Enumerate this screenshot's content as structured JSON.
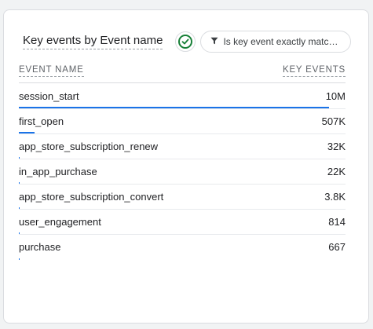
{
  "card": {
    "title": "Key events by Event name",
    "filter": {
      "icon": "filter-icon",
      "label": "Is key event exactly matc…"
    },
    "status_icon": "check-circle-icon",
    "columns": {
      "event_name": "EVENT NAME",
      "key_events": "KEY EVENTS"
    },
    "accent_color": "#1a73e8",
    "check_color": "#188038"
  },
  "chart_data": {
    "type": "table",
    "columns": [
      "EVENT NAME",
      "KEY EVENTS"
    ],
    "rows": [
      {
        "event": "session_start",
        "value_label": "10M",
        "value": 10000000
      },
      {
        "event": "first_open",
        "value_label": "507K",
        "value": 507000
      },
      {
        "event": "app_store_subscription_renew",
        "value_label": "32K",
        "value": 32000
      },
      {
        "event": "in_app_purchase",
        "value_label": "22K",
        "value": 22000
      },
      {
        "event": "app_store_subscription_convert",
        "value_label": "3.8K",
        "value": 3800
      },
      {
        "event": "user_engagement",
        "value_label": "814",
        "value": 814
      },
      {
        "event": "purchase",
        "value_label": "667",
        "value": 667
      }
    ]
  }
}
